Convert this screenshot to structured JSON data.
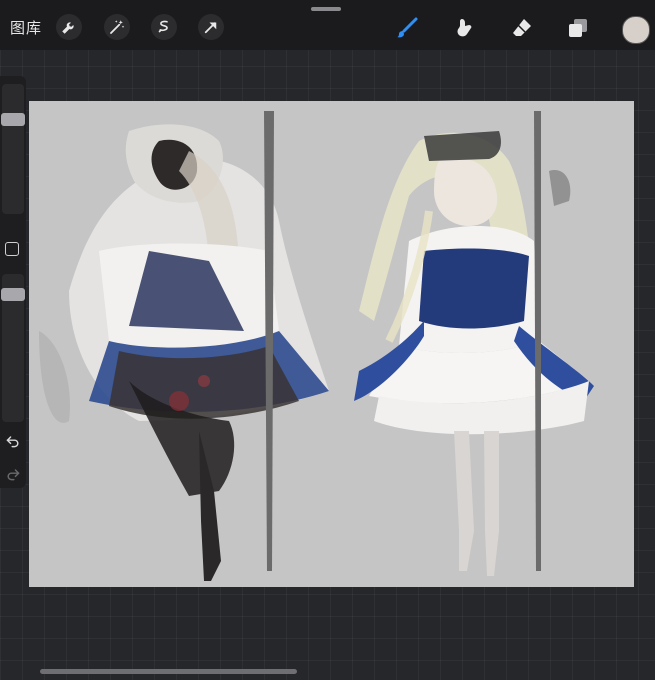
{
  "topbar": {
    "gallery_label": "图库",
    "left_tools": [
      "wrench-icon",
      "magic-wand-icon",
      "selection-icon",
      "transform-arrow-icon"
    ],
    "right_tools": [
      "brush-icon",
      "smudge-icon",
      "eraser-icon",
      "layers-icon"
    ],
    "active_tool": "brush-icon"
  },
  "colors": {
    "accent": "#2f8ff5",
    "current_color": "#d7cfca",
    "canvas_bg": "#c5c5c5"
  },
  "sidebar": {
    "brush_size_level": 0.25,
    "opacity_level": 0.1,
    "icons": [
      "modify-square-icon",
      "undo-icon",
      "redo-icon"
    ]
  },
  "canvas": {
    "content": "artwork-two-figures"
  }
}
